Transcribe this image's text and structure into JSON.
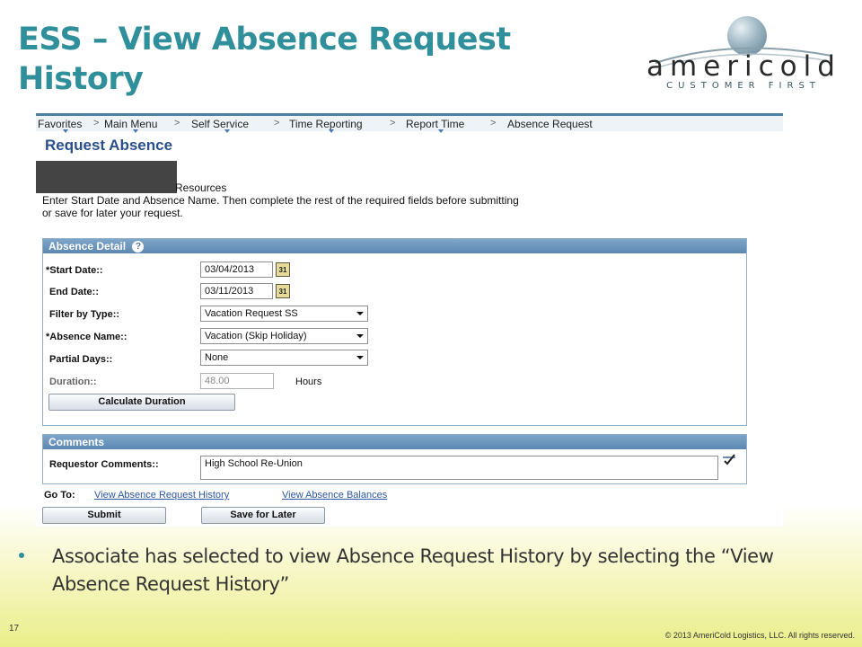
{
  "slide": {
    "title": "ESS – View Absence Request History",
    "bullet": "Associate has selected to view Absence Request History by selecting the “View Absence Request History”",
    "slide_number": "17",
    "copyright": "© 2013 AmeriCold Logistics, LLC. All rights reserved."
  },
  "logo": {
    "wordmark": "americold",
    "tagline": "CUSTOMER FIRST",
    "colors": {
      "globe": "#7d9aab",
      "text": "#2a2a2a",
      "swoosh": "#8aa0aa"
    }
  },
  "nav": {
    "items": [
      "Favorites",
      "Main Menu",
      "Self Service",
      "Time Reporting",
      "Report Time",
      "Absence Request"
    ],
    "separator": ">"
  },
  "page": {
    "heading": "Request Absence",
    "resources_text": "Resources",
    "instructions": "Enter Start Date and Absence Name. Then complete the rest of the required fields before submitting or save for later your request."
  },
  "absence_detail": {
    "header": "Absence Detail",
    "help_glyph": "?",
    "start_date_label": "*Start Date::",
    "start_date_value": "03/04/2013",
    "end_date_label": "End Date::",
    "end_date_value": "03/11/2013",
    "calendar_glyph": "31",
    "filter_label": "Filter by Type::",
    "filter_value": "Vacation Request SS",
    "absence_name_label": "*Absence Name::",
    "absence_name_value": "Vacation (Skip Holiday)",
    "partial_days_label": "Partial Days::",
    "partial_days_value": "None",
    "duration_label": "Duration::",
    "duration_value": "48.00",
    "duration_unit": "Hours",
    "calculate_button": "Calculate Duration"
  },
  "comments": {
    "header": "Comments",
    "requestor_label": "Requestor Comments::",
    "requestor_value": "High School Re-Union"
  },
  "goto": {
    "label": "Go To:",
    "history_link": "View Absence Request History",
    "balances_link": "View Absence Balances"
  },
  "actions": {
    "submit": "Submit",
    "save_later": "Save for Later"
  },
  "colors": {
    "title": "#2f8f9a",
    "heading": "#2b4e8c",
    "group_header": "#5b87b1",
    "link": "#2b57a5"
  }
}
